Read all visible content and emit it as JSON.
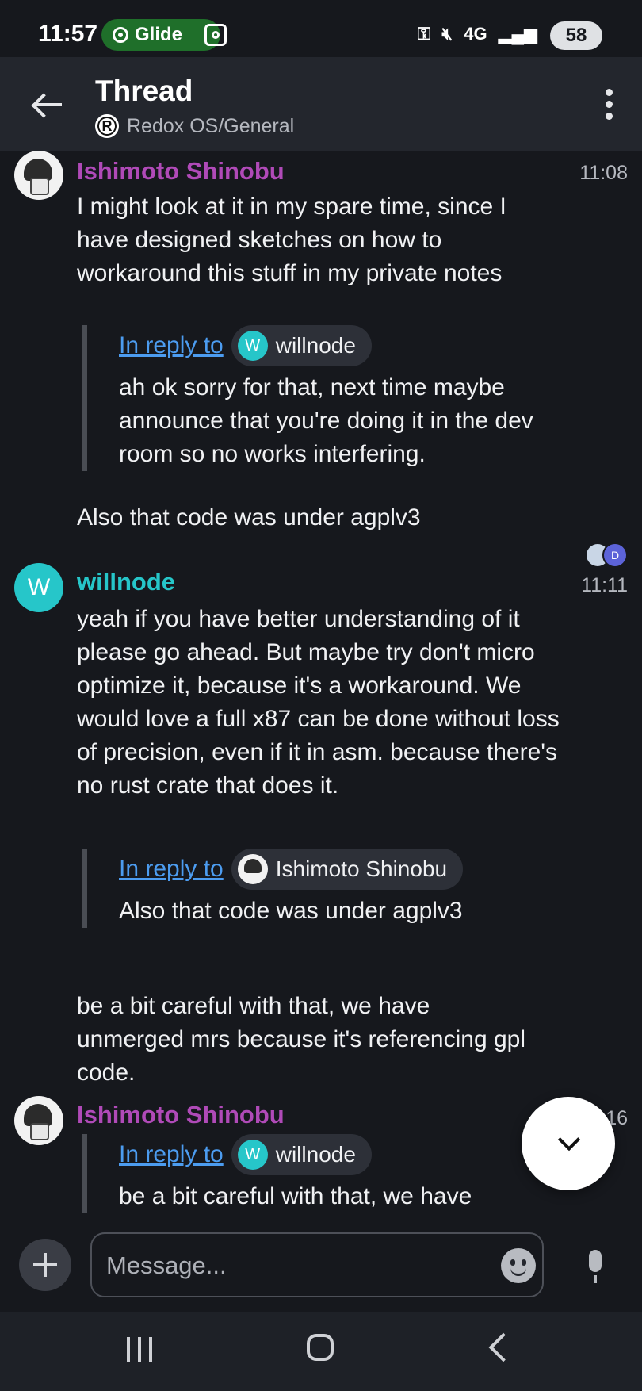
{
  "status_bar": {
    "time": "11:57",
    "app_chip": "Glide",
    "indicators": "4G",
    "battery": "58"
  },
  "header": {
    "title": "Thread",
    "room_logo": "R",
    "room": "Redox OS/General"
  },
  "messages": [
    {
      "sender": "Ishimoto Shinobu",
      "sender_color": "#b04ab8",
      "time": "11:08",
      "body": "I might look at it in my spare time,  since I have designed sketches on how to workaround this stuff in my private notes",
      "reply": {
        "link": "In reply to",
        "user_initial": "W",
        "user": "willnode",
        "text": "ah ok sorry for that, next time maybe announce that you're doing it in the dev room so no works interfering."
      },
      "after": "Also that code was under agplv3"
    },
    {
      "sender_initial": "W",
      "sender": "willnode",
      "sender_color": "#26c6c9",
      "time": "11:11",
      "body": "yeah if you have better understanding of it please go ahead. But maybe try don't micro optimize it, because it's a workaround. We would love a full x87 can be done without loss of precision, even if it in asm. because there's no rust crate that does it.",
      "reply": {
        "link": "In reply to",
        "user": "Ishimoto Shinobu",
        "text": "Also that code was under agplv3"
      },
      "after": "be a bit careful with that, we have unmerged mrs because it's referencing gpl code."
    },
    {
      "sender": "Ishimoto Shinobu",
      "sender_color": "#b04ab8",
      "time_partial": "16",
      "reply": {
        "link": "In reply to",
        "user_initial": "W",
        "user": "willnode",
        "text": "be a bit careful with that, we have"
      }
    }
  ],
  "receipts": {
    "initial": "D"
  },
  "composer": {
    "placeholder": "Message..."
  }
}
